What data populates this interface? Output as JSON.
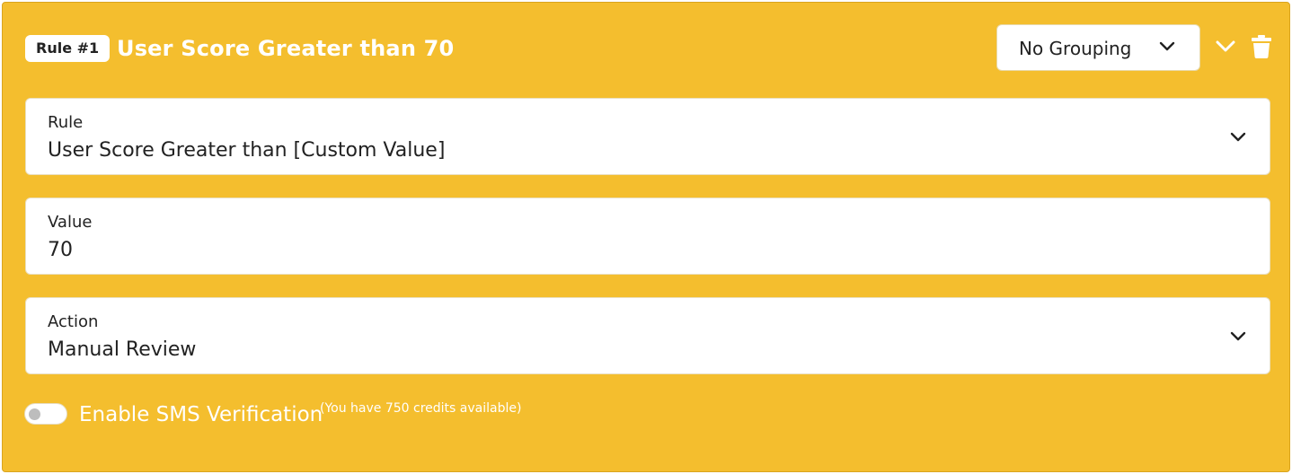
{
  "rule": {
    "badge": "Rule #1",
    "title": "User Score Greater than 70"
  },
  "grouping": {
    "selected": "No Grouping"
  },
  "fields": {
    "rule": {
      "label": "Rule",
      "value": "User Score Greater than [Custom Value]"
    },
    "value": {
      "label": "Value",
      "value": "70"
    },
    "action": {
      "label": "Action",
      "value": "Manual Review"
    }
  },
  "sms": {
    "label": "Enable SMS Verification",
    "credits": "(You have 750 credits available)",
    "enabled": false
  },
  "colors": {
    "card_background": "#f4be2e",
    "field_background": "#ffffff",
    "text_dark": "#222222",
    "text_light": "#ffffff"
  },
  "icons": {
    "collapse": "chevron-down-icon",
    "delete": "trash-icon",
    "dropdown": "chevron-down-icon"
  }
}
